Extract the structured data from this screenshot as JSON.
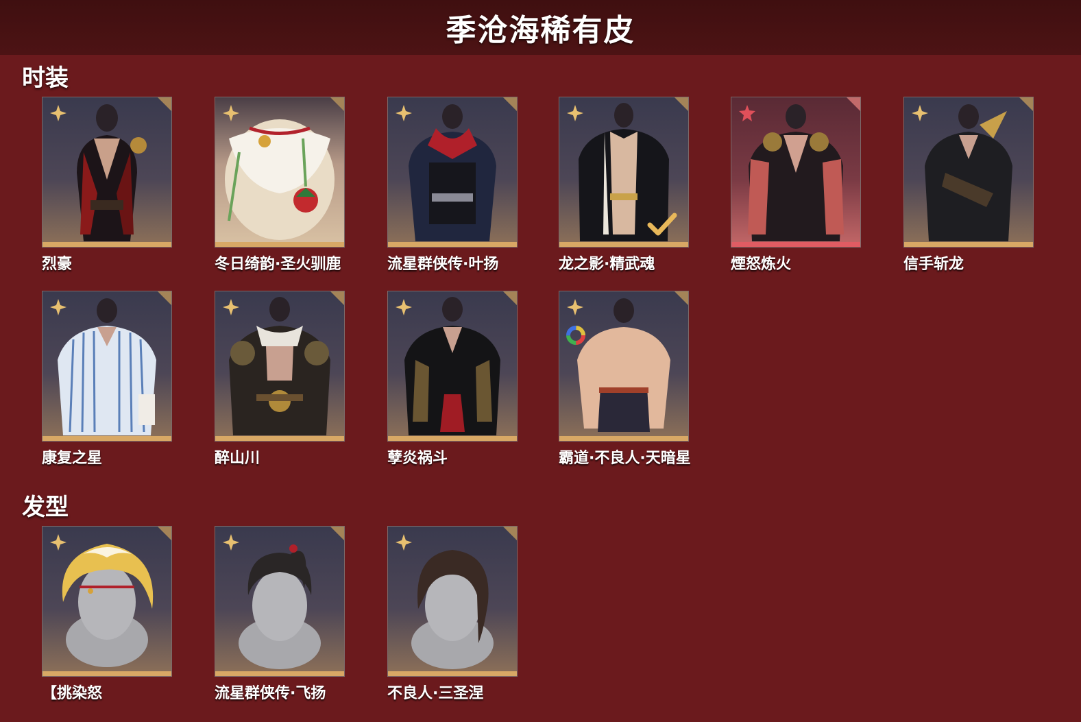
{
  "page": {
    "title": "季沧海稀有皮"
  },
  "sections": {
    "outfits": {
      "title": "时装",
      "items": [
        {
          "name": "烈豪",
          "rarity": "gold"
        },
        {
          "name": "冬日绮韵·圣火驯鹿",
          "rarity": "gold"
        },
        {
          "name": "流星群侠传·叶扬",
          "rarity": "gold"
        },
        {
          "name": "龙之影·精武魂",
          "rarity": "gold"
        },
        {
          "name": "煙怒炼火",
          "rarity": "red"
        },
        {
          "name": "信手斩龙",
          "rarity": "gold"
        },
        {
          "name": "康复之星",
          "rarity": "gold"
        },
        {
          "name": "醉山川",
          "rarity": "gold"
        },
        {
          "name": "孽炎祸斗",
          "rarity": "gold"
        },
        {
          "name": "霸道·不良人·天暗星",
          "rarity": "gold"
        }
      ]
    },
    "hairstyles": {
      "title": "发型",
      "items": [
        {
          "name": "【挑染怒",
          "rarity": "gold"
        },
        {
          "name": "流星群侠传·飞扬",
          "rarity": "gold"
        },
        {
          "name": "不良人·三圣涅",
          "rarity": "gold"
        }
      ]
    }
  },
  "colors": {
    "background": "#6b1a1d",
    "header": "#4d1314",
    "gold_bar": "#d8a865",
    "red_bar": "#e05c63",
    "gold_star": "#e8c070",
    "red_star": "#e0505a"
  },
  "icons": {
    "rarity_gold": "gold-star-icon",
    "rarity_red": "red-star-icon",
    "owned": "check-icon",
    "dye": "color-ring-icon"
  }
}
